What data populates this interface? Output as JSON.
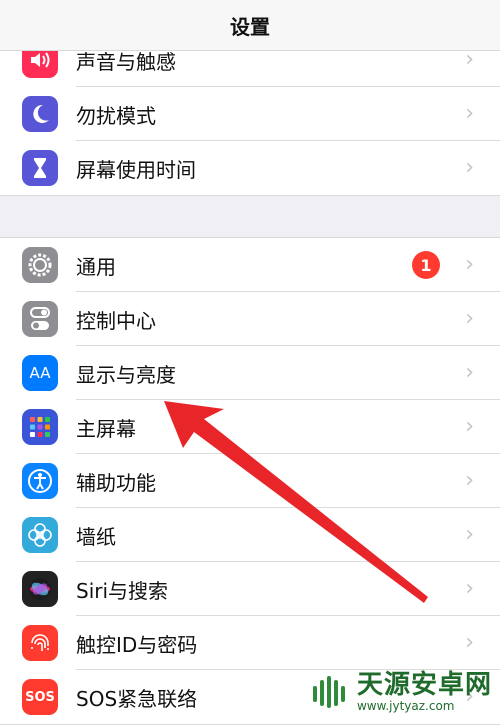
{
  "header": {
    "title": "设置"
  },
  "groups": [
    {
      "items": [
        {
          "label": "声音与触感",
          "icon": "speaker-icon",
          "color": "#ff2d55"
        },
        {
          "label": "勿扰模式",
          "icon": "moon-icon",
          "color": "#5856d6"
        },
        {
          "label": "屏幕使用时间",
          "icon": "hourglass-icon",
          "color": "#5856d6"
        }
      ]
    },
    {
      "items": [
        {
          "label": "通用",
          "icon": "gear-icon",
          "color": "#8e8e93",
          "badge": "1"
        },
        {
          "label": "控制中心",
          "icon": "toggle-icon",
          "color": "#8e8e93"
        },
        {
          "label": "显示与亮度",
          "icon": "aa-icon",
          "color": "#007aff"
        },
        {
          "label": "主屏幕",
          "icon": "home-screen-icon",
          "color": "#3a55d8"
        },
        {
          "label": "辅助功能",
          "icon": "accessibility-icon",
          "color": "#0a84ff"
        },
        {
          "label": "墙纸",
          "icon": "wallpaper-icon",
          "color": "#34aadc"
        },
        {
          "label": "Siri与搜索",
          "icon": "siri-icon",
          "color": "#222222"
        },
        {
          "label": "触控ID与密码",
          "icon": "fingerprint-icon",
          "color": "#ff3b30"
        },
        {
          "label": "SOS紧急联络",
          "icon": "sos-icon",
          "color": "#ff3b30"
        }
      ]
    }
  ],
  "icons": {
    "aa_text": "AA",
    "sos_text": "SOS"
  },
  "annotation": {
    "arrow_color": "#e8262a"
  },
  "watermark": {
    "title": "天源安卓网",
    "url": "www.jytyaz.com",
    "logo": "android-logo-icon"
  }
}
